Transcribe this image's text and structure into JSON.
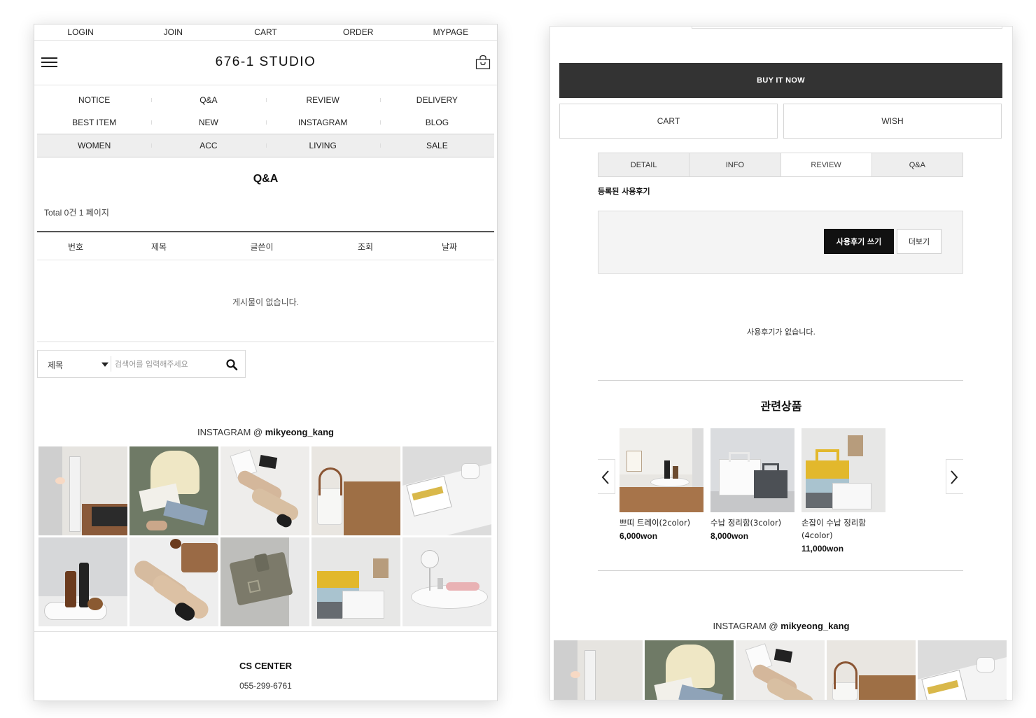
{
  "left": {
    "topnav": [
      "LOGIN",
      "JOIN",
      "CART",
      "ORDER",
      "MYPAGE"
    ],
    "logo": "676-1 STUDIO",
    "menu_rows": [
      [
        "NOTICE",
        "Q&A",
        "REVIEW",
        "DELIVERY"
      ],
      [
        "BEST ITEM",
        "NEW",
        "INSTAGRAM",
        "BLOG"
      ],
      [
        "WOMEN",
        "ACC",
        "LIVING",
        "SALE"
      ]
    ],
    "board": {
      "title": "Q&A",
      "total": "Total 0건 1 페이지",
      "columns": [
        "번호",
        "제목",
        "글쓴이",
        "조회",
        "날짜"
      ],
      "empty": "게시물이 없습니다."
    },
    "search": {
      "field_label": "제목",
      "placeholder": "검색어를 입력해주세요"
    },
    "instagram": {
      "prefix": "INSTAGRAM @ ",
      "handle": "mikyeong_kang"
    },
    "cs": {
      "title": "CS CENTER",
      "phone": "055-299-6761"
    }
  },
  "right": {
    "buy_now": "BUY IT NOW",
    "cart": "CART",
    "wish": "WISH",
    "tabs": [
      "DETAIL",
      "INFO",
      "REVIEW",
      "Q&A"
    ],
    "active_tab": "REVIEW",
    "review": {
      "title": "등록된 사용후기",
      "write": "사용후기 쓰기",
      "more": "더보기",
      "empty": "사용후기가 없습니다."
    },
    "related": {
      "title": "관련상품",
      "products": [
        {
          "name": "쁘띠 트레이(2color)",
          "price": "6,000won"
        },
        {
          "name": "수납 정리함(3color)",
          "price": "8,000won"
        },
        {
          "name": "손잡이 수납 정리함 (4color)",
          "price": "11,000won"
        }
      ]
    },
    "instagram": {
      "prefix": "INSTAGRAM @ ",
      "handle": "mikyeong_kang"
    }
  },
  "icons": {
    "menu": "hamburger-icon",
    "cart": "shopping-bag-icon",
    "search": "search-icon",
    "prev": "chevron-left-icon",
    "next": "chevron-right-icon",
    "dropdown": "caret-down-icon"
  },
  "colors": {
    "buy_button": "#333333",
    "write_button": "#111111",
    "menu_active_row": "#eeeeee",
    "tab_inactive": "#eeeeee"
  }
}
